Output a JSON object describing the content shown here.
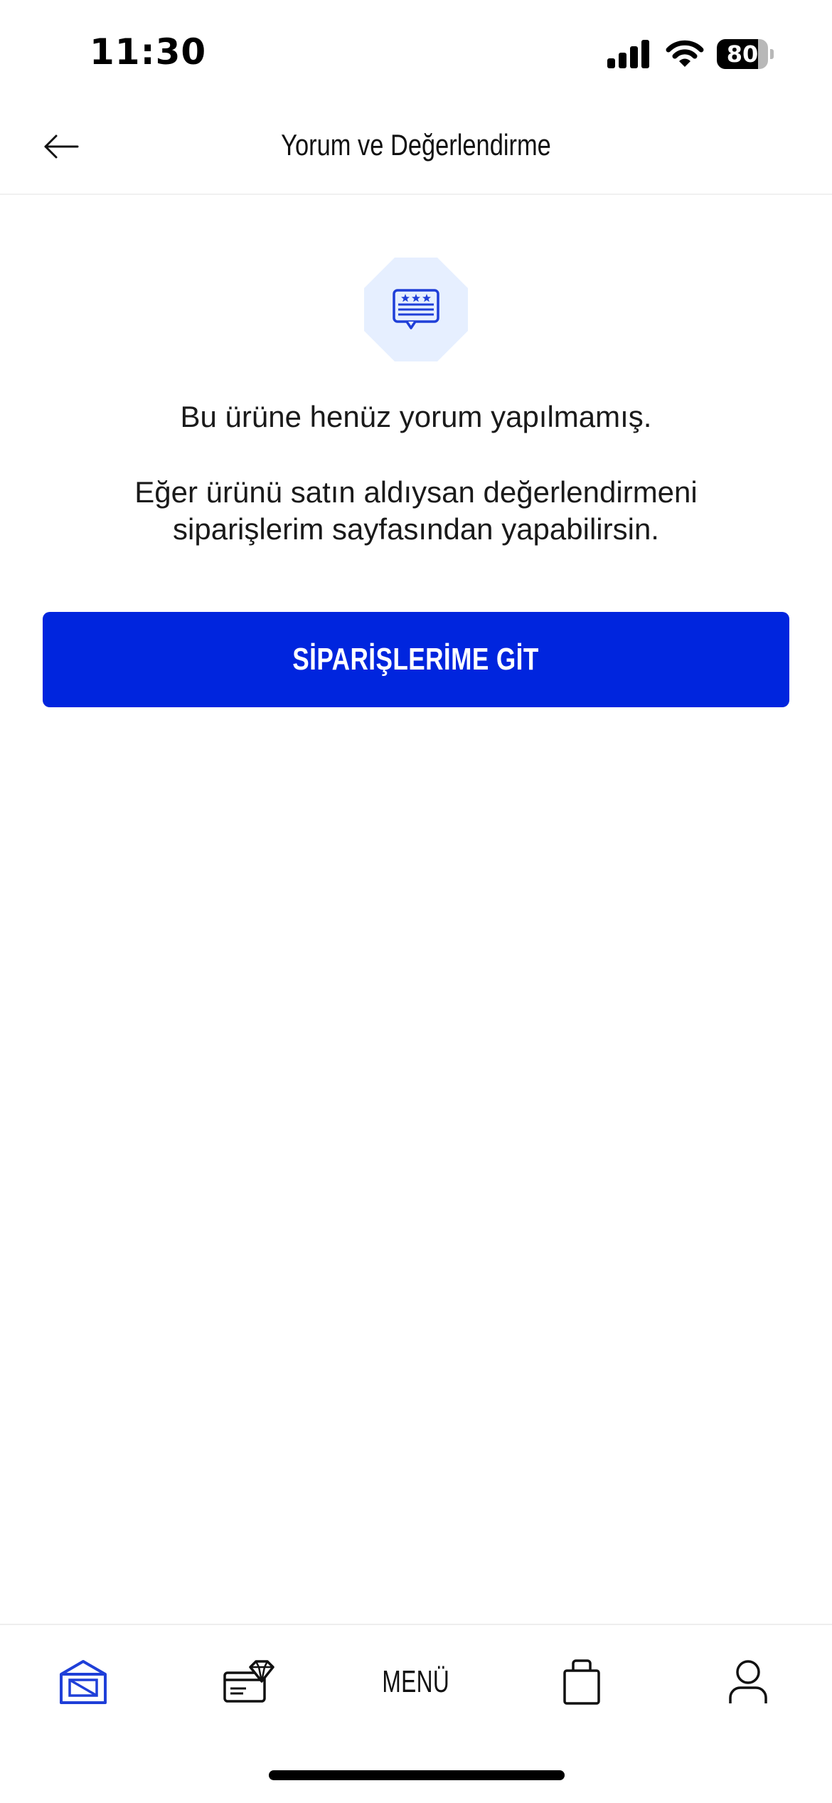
{
  "status_bar": {
    "time": "11:30",
    "battery_percent": "80",
    "battery_level": 0.8
  },
  "header": {
    "title": "Yorum ve Değerlendirme",
    "back_icon": "arrow-left-icon"
  },
  "empty_state": {
    "icon": "review-stars-icon",
    "title": "Bu ürüne henüz yorum yapılmamış.",
    "description_line1": "Eğer ürünü satın aldıysan değerlendirmeni",
    "description_line2": "siparişlerim sayfasından yapabilirsin.",
    "button_label": "SİPARİŞLERİME GİT"
  },
  "tab_bar": {
    "items": [
      {
        "id": "home",
        "icon": "home-icon",
        "active": true
      },
      {
        "id": "deals",
        "icon": "gift-card-diamond-icon",
        "active": false
      },
      {
        "id": "menu",
        "label": "MENÜ",
        "active": false
      },
      {
        "id": "cart",
        "icon": "shopping-bag-icon",
        "active": false
      },
      {
        "id": "account",
        "icon": "user-icon",
        "active": false
      }
    ]
  },
  "colors": {
    "accent": "#0025de",
    "badge_bg": "#e6efff",
    "text": "#1a1a1a"
  }
}
